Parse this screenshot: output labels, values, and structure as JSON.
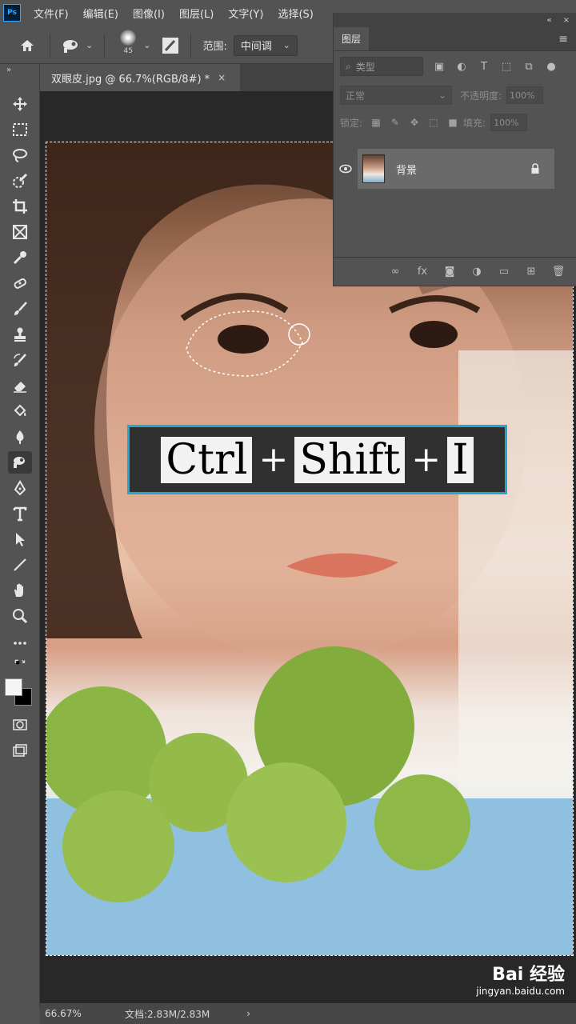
{
  "app": {
    "logo": "Ps"
  },
  "menu": [
    "文件(F)",
    "编辑(E)",
    "图像(I)",
    "图层(L)",
    "文字(Y)",
    "选择(S)"
  ],
  "options": {
    "brush_size": "45",
    "range_label": "范围:",
    "range_value": "中间调"
  },
  "document": {
    "tab_title": "双眼皮.jpg @ 66.7%(RGB/8#) *",
    "close": "×"
  },
  "shortcut": {
    "key1": "Ctrl",
    "plus": "+",
    "key2": "Shift",
    "key3": "I"
  },
  "layers": {
    "panel_title": "图层",
    "search_placeholder": "类型",
    "blend_mode": "正常",
    "opacity_label": "不透明度:",
    "opacity_value": "100%",
    "lock_label": "锁定:",
    "fill_label": "填充:",
    "fill_value": "100%",
    "layer_name": "背景"
  },
  "status": {
    "zoom": "66.67%",
    "doc_info": "文档:2.83M/2.83M",
    "arrow": "›"
  },
  "watermark": {
    "logo": "Bai 经验",
    "url": "jingyan.baidu.com"
  },
  "icons": [
    "home-icon",
    "dodge-tool-icon",
    "move-icon",
    "marquee-icon",
    "lasso-icon",
    "quick-select-icon",
    "crop-icon",
    "frame-icon",
    "eyedropper-icon",
    "healing-icon",
    "brush-icon",
    "stamp-icon",
    "history-brush-icon",
    "eraser-icon",
    "paint-bucket-icon",
    "blur-icon",
    "dodge-icon",
    "pen-icon",
    "type-icon",
    "path-select-icon",
    "line-icon",
    "hand-icon",
    "zoom-icon",
    "more-tools-icon",
    "eye-icon",
    "lock-icon"
  ],
  "colors": {
    "accent": "#22a6d6",
    "panel": "#535353",
    "canvas": "#282828"
  }
}
